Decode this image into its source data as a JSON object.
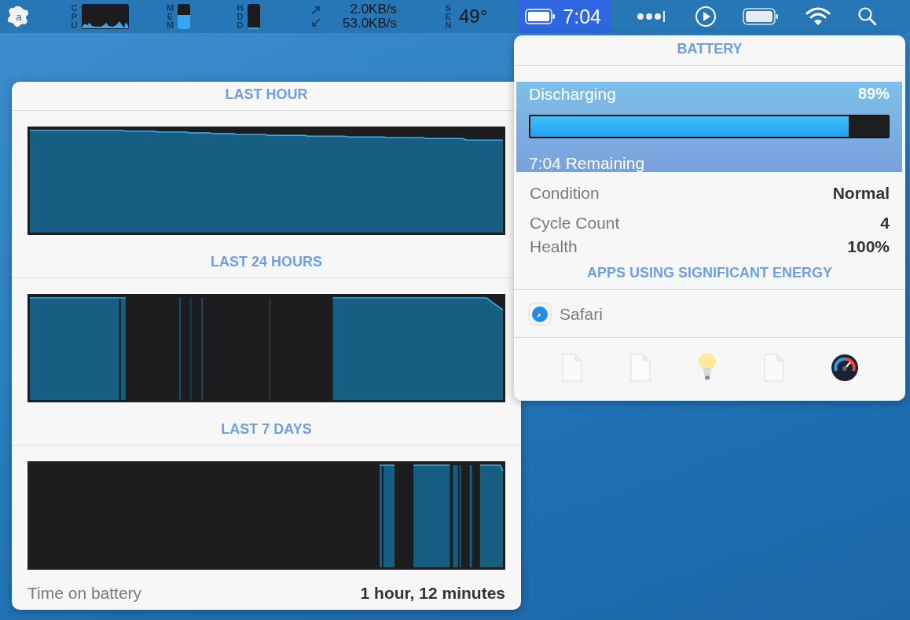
{
  "menu_bar": {
    "logo": {
      "letter": "a"
    },
    "cpu": {
      "label": "CPU"
    },
    "memory": {
      "label": "MEM",
      "level": 0.55
    },
    "disk": {
      "label": "HDD",
      "level": 0.06
    },
    "network": {
      "upload": "2.0KB/s",
      "download": "53.0KB/s"
    },
    "sensors": {
      "label": "SEN",
      "reading": "49°"
    },
    "battery_item": {
      "time": "7:04",
      "selected": true
    }
  },
  "history_panel": {
    "sections": [
      {
        "title": "LAST HOUR"
      },
      {
        "title": "LAST 24 HOURS"
      },
      {
        "title": "LAST 7 DAYS"
      }
    ],
    "footer": {
      "label": "Time on battery",
      "value": "1 hour, 12 minutes"
    }
  },
  "battery_panel": {
    "title": "BATTERY",
    "status": "Discharging",
    "percent": "89%",
    "level": 0.89,
    "remaining": "7:04 Remaining",
    "details": [
      {
        "label": "Condition",
        "value": "Normal"
      },
      {
        "label": "Cycle Count",
        "value": "4"
      },
      {
        "label": "Health",
        "value": "100%"
      }
    ],
    "apps_title": "APPS USING SIGNIFICANT ENERGY",
    "apps": [
      {
        "name": "Safari"
      }
    ]
  }
}
